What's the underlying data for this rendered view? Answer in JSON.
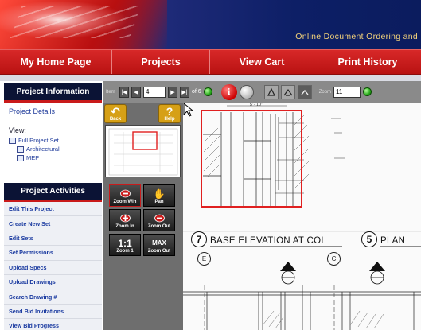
{
  "header": {
    "tagline": "Online Document Ordering and"
  },
  "nav": [
    {
      "label": "My Home Page",
      "width": 141
    },
    {
      "label": "Projects",
      "width": 123
    },
    {
      "label": "View Cart",
      "width": 131
    },
    {
      "label": "Print History",
      "width": 134
    }
  ],
  "sidebar": {
    "project_info_title": "Project Information",
    "project_details_link": "Project Details",
    "view_label": "View:",
    "tree": {
      "root": "Full Project Set",
      "children": [
        "Architectural",
        "MEP"
      ]
    },
    "activities_title": "Project Activities",
    "activities": [
      "Edit This Project",
      "Create New Set",
      "Edit Sets",
      "Set Permissions",
      "Upload Specs",
      "Upload Drawings",
      "Search Drawing #",
      "Send Bid Invitations",
      "View Bid Progress"
    ]
  },
  "toolbar": {
    "item_label": "Item",
    "first": "|◀",
    "prev": "◀",
    "next": "▶",
    "last": "▶|",
    "page_value": "4",
    "of_label": "of 6",
    "info_label": "i",
    "zoom_label": "Zoom",
    "zoom_value": "11"
  },
  "tools": {
    "back_label": "Back",
    "help_label": "Help",
    "zoom_window_label": "Zoom Win",
    "pan_label": "Pan",
    "zoom_in_label": "Zoom In",
    "zoom_out_label": "Zoom Out",
    "one_to_one_glyph": "1:1",
    "zoom_1_label": "Zoom 1",
    "max_glyph": "MAX",
    "zoom_max_label": "Zoom Out"
  },
  "drawing": {
    "base_number": "7",
    "base_title": "BASE ELEVATION AT COL",
    "plan_number": "5",
    "plan_title": "PLAN",
    "dim_text": "5' - 10\"",
    "grid_e": "E",
    "grid_c": "C"
  }
}
